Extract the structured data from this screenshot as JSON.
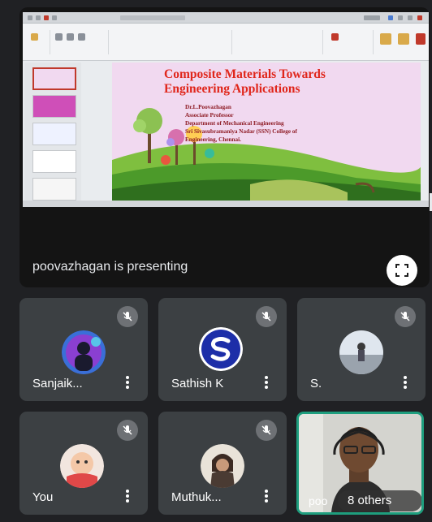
{
  "presentation": {
    "presenting_label": "poovazhagan is presenting",
    "fullscreen_icon": "fullscreen-icon",
    "slide": {
      "title_line1": "Composite Materials Towards",
      "title_line2": "Engineering Applications",
      "presenter_name": "Dr.L.Poovazhagan",
      "presenter_role": "Associate Professor",
      "department": "Department of Mechanical Engineering",
      "college_line1": "Sri Sivasubramaniya Nadar (SSN) College of",
      "college_line2": "Engineering, Chennai."
    }
  },
  "participants": [
    {
      "name": "Sanjaik...",
      "muted": true,
      "avatar": "avatar-photo-person"
    },
    {
      "name": "Sathish K",
      "muted": true,
      "avatar": "avatar-s-logo"
    },
    {
      "name": "S.",
      "muted": true,
      "avatar": "avatar-photo-landscape"
    },
    {
      "name": "You",
      "muted": true,
      "avatar": "avatar-photo-baby"
    },
    {
      "name": "Muthuk...",
      "muted": true,
      "avatar": "avatar-photo-warrior"
    }
  ],
  "video_tile": {
    "self_label": "poo",
    "others_label": "8 others"
  },
  "colors": {
    "background": "#202124",
    "tile": "#3c4043",
    "active_speaker_border": "#1e9e7e",
    "slide_title": "#e0261b"
  }
}
